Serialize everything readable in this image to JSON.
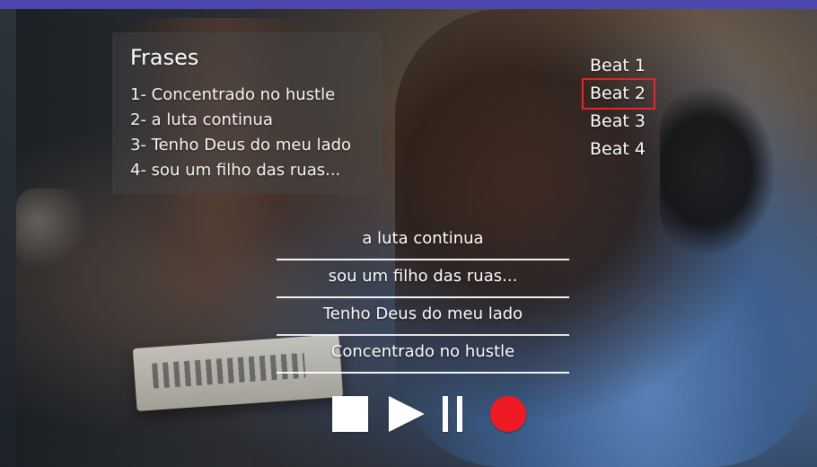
{
  "phrases": {
    "title": "Frases",
    "items": [
      "1- Concentrado no hustle",
      "2- a luta continua",
      "3- Tenho Deus do meu lado",
      "4- sou um filho das ruas..."
    ]
  },
  "beats": {
    "items": [
      "Beat 1",
      "Beat 2",
      "Beat 3",
      "Beat 4"
    ],
    "selected_index": 1
  },
  "sequence": {
    "slots": [
      "a luta continua",
      "sou um filho das ruas...",
      "Tenho Deus do meu lado",
      "Concentrado no hustle"
    ]
  },
  "controls": {
    "stop": "stop-icon",
    "play": "play-icon",
    "pause": "pause-icon",
    "record": "record-icon"
  },
  "colors": {
    "top_band": "#4f47b0",
    "selection_outline": "#e5262b",
    "record": "#ee1b24"
  }
}
